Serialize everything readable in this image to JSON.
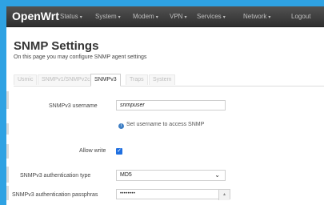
{
  "navbar": {
    "brand": "OpenWrt",
    "items": [
      {
        "label": "Status",
        "caret": "▾"
      },
      {
        "label": "System",
        "caret": "▾"
      },
      {
        "label": "Modem",
        "caret": "▾"
      },
      {
        "label": "VPN",
        "caret": "▾"
      },
      {
        "label": "Services",
        "caret": "▾"
      },
      {
        "label": "Network",
        "caret": "▾"
      },
      {
        "label": "Logout",
        "caret": ""
      }
    ]
  },
  "page": {
    "title": "SNMP Settings",
    "subtitle": "On this page you may configure SNMP agent settings"
  },
  "tabs": [
    {
      "label": "Usmic",
      "active": false
    },
    {
      "label": "SNMPv1/SNMPv2c",
      "active": false
    },
    {
      "label": "SNMPv3",
      "active": true
    },
    {
      "label": "Traps",
      "active": false
    },
    {
      "label": "System",
      "active": false
    }
  ],
  "form": {
    "username_label": "SNMPv3 username",
    "username_value": "snmpuser",
    "username_hint": "Set username to access SNMP",
    "hint_icon": "info-icon",
    "allow_write_label": "Allow write",
    "allow_write_checked": true,
    "auth_type_label": "SNMPv3 authentication type",
    "auth_type_value": "MD5",
    "auth_pass_label": "SNMPv3 authentication passphras",
    "auth_pass_value": "••••••••"
  },
  "colors": {
    "border_accent": "#2fa2e3",
    "navbar": "#3a3a3a",
    "checkbox": "#1f6fe0",
    "info_icon": "#3f7fc4"
  }
}
